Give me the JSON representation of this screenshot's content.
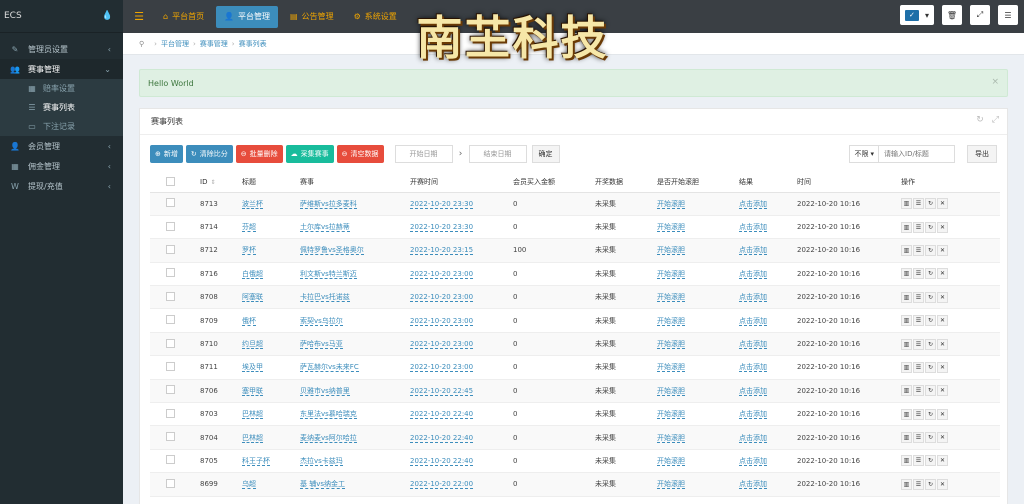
{
  "sidebar": {
    "logo_text": "ECS",
    "logo_drop": "💧",
    "items": [
      {
        "label": "管理员设置",
        "icon": "wrench-icon",
        "glyph": "✎"
      },
      {
        "label": "赛事管理",
        "icon": "users-icon",
        "glyph": "👥"
      },
      {
        "label": "会员管理",
        "icon": "user-icon",
        "glyph": "👤"
      },
      {
        "label": "佣金管理",
        "icon": "table-icon",
        "glyph": "▦"
      },
      {
        "label": "提现/充值",
        "icon": "w-icon",
        "glyph": "W"
      }
    ],
    "subitems": [
      {
        "label": "赔率设置",
        "glyph": "▦"
      },
      {
        "label": "赛事列表",
        "glyph": "☰"
      },
      {
        "label": "下注记录",
        "glyph": "▭"
      }
    ]
  },
  "topnav": {
    "toggle": "☰",
    "tabs": [
      {
        "label": "平台首页",
        "glyph": "⌂"
      },
      {
        "label": "平台管理",
        "glyph": "👤"
      },
      {
        "label": "公告管理",
        "glyph": "▤"
      },
      {
        "label": "系统设置",
        "glyph": "⚙"
      }
    ],
    "right_buttons": [
      "🗑",
      "⤢",
      "☰"
    ],
    "theme_glyph": "✓",
    "theme_caret": "▾"
  },
  "brand": {
    "text": "南芏科技"
  },
  "breadcrumb": {
    "pin": "⚲",
    "items": [
      "平台管理",
      "赛事管理",
      "赛事列表"
    ]
  },
  "alert": {
    "message": "Hello World",
    "close": "×"
  },
  "panel": {
    "title": "赛事列表",
    "tools": [
      "↻",
      "⤢"
    ]
  },
  "toolbar": {
    "buttons": [
      {
        "label": "新增",
        "glyph": "⊕",
        "color": "#3c8dbc"
      },
      {
        "label": "清除比分",
        "glyph": "↻",
        "color": "#3c8dbc"
      },
      {
        "label": "批量删除",
        "glyph": "⊖",
        "color": "#e74c3c"
      },
      {
        "label": "采集赛事",
        "glyph": "☁",
        "color": "#18bc9c"
      },
      {
        "label": "清空数据",
        "glyph": "⊖",
        "color": "#e74c3c"
      }
    ],
    "start_date": "开始日期",
    "end_date": "结束日期",
    "arrow": "›",
    "confirm": "确定"
  },
  "search": {
    "select_value": "不限",
    "select_caret": "▾",
    "placeholder": "请输入ID/标题",
    "export": "导出"
  },
  "table": {
    "columns": [
      "ID",
      "标题",
      "赛事",
      "开赛时间",
      "会员买入金额",
      "开奖数据",
      "是否开始滚胆",
      "结果",
      "时间",
      "操作"
    ],
    "sort_glyph": "⇕",
    "rows": [
      {
        "id": "8713",
        "title": "波兰杯",
        "match": "萨维斯vs拉多麦科",
        "start": "2022-10-20 23:30",
        "amount": "0",
        "draw": "未采集",
        "rolling": "开始滚胆",
        "result": "点击添加",
        "time": "2022-10-20 10:16"
      },
      {
        "id": "8714",
        "title": "芬超",
        "match": "土尔库vs拉赫蒂",
        "start": "2022-10-20 23:30",
        "amount": "0",
        "draw": "未采集",
        "rolling": "开始滚胆",
        "result": "点击添加",
        "time": "2022-10-20 10:16"
      },
      {
        "id": "8712",
        "title": "罗杯",
        "match": "佩特罗鲁vs圣格奥尔",
        "start": "2022-10-20 23:15",
        "amount": "100",
        "draw": "未采集",
        "rolling": "开始滚胆",
        "result": "点击添加",
        "time": "2022-10-20 10:16"
      },
      {
        "id": "8716",
        "title": "白俄超",
        "match": "利文斯vs特兰斯迈",
        "start": "2022-10-20 23:00",
        "amount": "0",
        "draw": "未采集",
        "rolling": "开始滚胆",
        "result": "点击添加",
        "time": "2022-10-20 10:16"
      },
      {
        "id": "8708",
        "title": "阿塞联",
        "match": "卡拉巴vs托诺兹",
        "start": "2022-10-20 23:00",
        "amount": "0",
        "draw": "未采集",
        "rolling": "开始滚胆",
        "result": "点击添加",
        "time": "2022-10-20 10:16"
      },
      {
        "id": "8709",
        "title": "俄杯",
        "match": "索契vs乌拉尔",
        "start": "2022-10-20 23:00",
        "amount": "0",
        "draw": "未采集",
        "rolling": "开始滚胆",
        "result": "点击添加",
        "time": "2022-10-20 10:16"
      },
      {
        "id": "8710",
        "title": "约旦超",
        "match": "萨哈布vs马亚",
        "start": "2022-10-20 23:00",
        "amount": "0",
        "draw": "未采集",
        "rolling": "开始滚胆",
        "result": "点击添加",
        "time": "2022-10-20 10:16"
      },
      {
        "id": "8711",
        "title": "埃及甲",
        "match": "萨瓦赫尔vs未来FC",
        "start": "2022-10-20 23:00",
        "amount": "0",
        "draw": "未采集",
        "rolling": "开始滚胆",
        "result": "点击添加",
        "time": "2022-10-20 10:16"
      },
      {
        "id": "8706",
        "title": "塞甲联",
        "match": "贝雅市vs纳普里",
        "start": "2022-10-20 22:45",
        "amount": "0",
        "draw": "未采集",
        "rolling": "开始滚胆",
        "result": "点击添加",
        "time": "2022-10-20 10:16"
      },
      {
        "id": "8703",
        "title": "巴林超",
        "match": "东里法vs慕哈瑞克",
        "start": "2022-10-20 22:40",
        "amount": "0",
        "draw": "未采集",
        "rolling": "开始滚胆",
        "result": "点击添加",
        "time": "2022-10-20 10:16"
      },
      {
        "id": "8704",
        "title": "巴林超",
        "match": "麦纳麦vs阿尔哈拉",
        "start": "2022-10-20 22:40",
        "amount": "0",
        "draw": "未采集",
        "rolling": "开始滚胆",
        "result": "点击添加",
        "time": "2022-10-20 10:16"
      },
      {
        "id": "8705",
        "title": "科王子杯",
        "match": "杰拉vs卡兹玛",
        "start": "2022-10-20 22:40",
        "amount": "0",
        "draw": "未采集",
        "rolling": "开始滚胆",
        "result": "点击添加",
        "time": "2022-10-20 10:16"
      },
      {
        "id": "8699",
        "title": "乌超",
        "match": "基 辅vs纳金工",
        "start": "2022-10-20 22:00",
        "amount": "0",
        "draw": "未采集",
        "rolling": "开始滚胆",
        "result": "点击添加",
        "time": "2022-10-20 10:16"
      }
    ],
    "op_glyphs": [
      "▥",
      "☰",
      "↻",
      "✕"
    ]
  },
  "colors": {
    "sidebar_bg": "#222d32",
    "topnav_bg": "#3a3f44",
    "accent": "#3c8dbc",
    "nav_text": "#f0a500",
    "alert_bg": "#dff0e3"
  }
}
